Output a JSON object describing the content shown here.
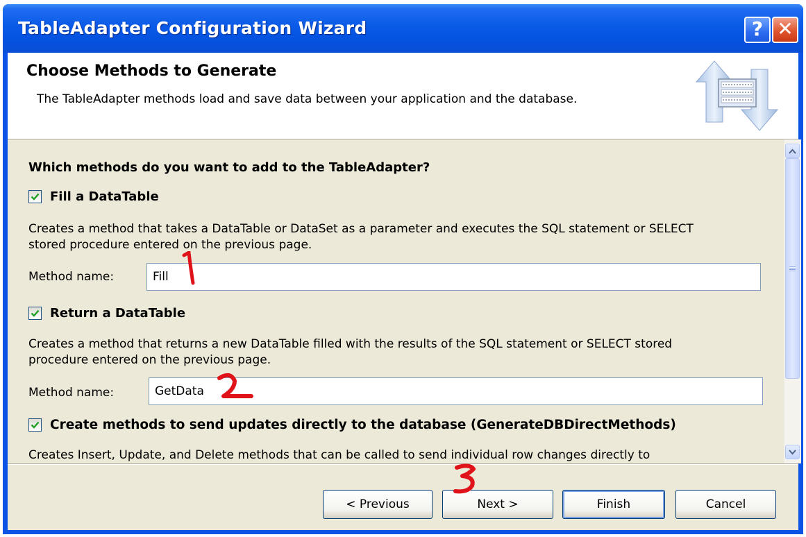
{
  "window": {
    "title": "TableAdapter Configuration Wizard",
    "help_symbol": "?",
    "close_symbol": "✕"
  },
  "header": {
    "title": "Choose Methods to Generate",
    "description": "The TableAdapter methods load and save data between your application and the database.",
    "icon": "database-transfer-arrows-icon"
  },
  "content": {
    "question": "Which methods do you want to add to the TableAdapter?",
    "options": [
      {
        "label": "Fill a DataTable",
        "checked": true,
        "description": "Creates a method that takes a DataTable or DataSet as a parameter and executes the SQL statement or SELECT stored procedure entered on the previous page.",
        "method_label": "Method name:",
        "method_value": "Fill"
      },
      {
        "label": "Return a DataTable",
        "checked": true,
        "description": "Creates a method that returns a new DataTable filled with the results of the SQL statement or SELECT stored procedure entered on the previous page.",
        "method_label": "Method name:",
        "method_value": "GetData"
      },
      {
        "label": "Create methods to send updates directly to the database (GenerateDBDirectMethods)",
        "checked": true,
        "description": "Creates Insert, Update, and Delete methods that can be called to send individual row changes directly to"
      }
    ]
  },
  "buttons": {
    "previous": "< Previous",
    "next": "Next >",
    "finish": "Finish",
    "cancel": "Cancel"
  },
  "annotations": [
    "1",
    "2",
    "3"
  ],
  "colors": {
    "title_bar": "#0a5ae8",
    "dialog_background": "#ece9d8",
    "annotation_ink": "#e0131a"
  }
}
